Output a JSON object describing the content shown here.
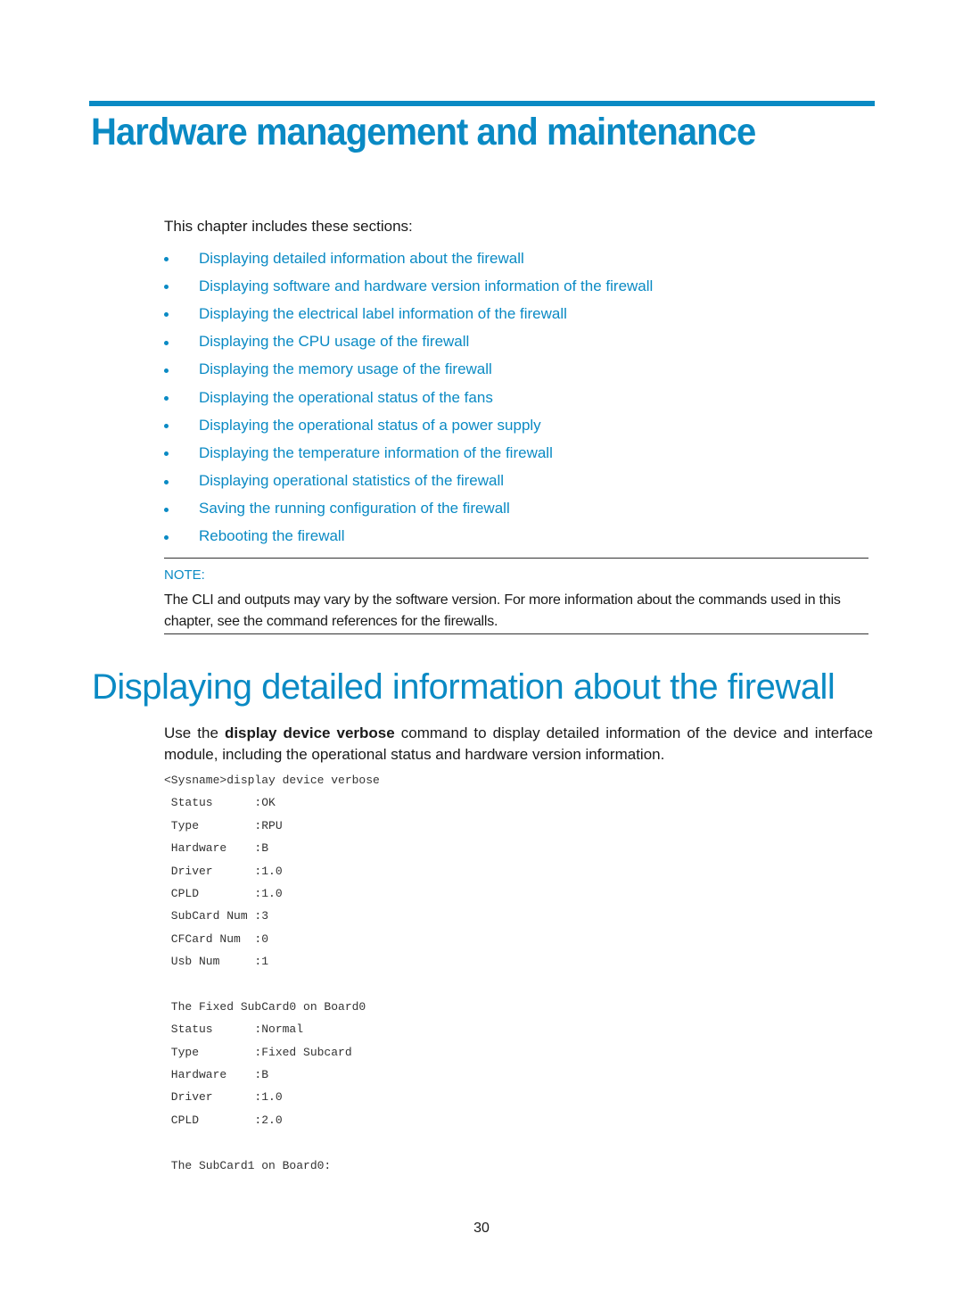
{
  "chapter": {
    "title": "Hardware management and maintenance",
    "intro": "This chapter includes these sections:",
    "toc": [
      "Displaying detailed information about the firewall",
      "Displaying software and hardware version information of the firewall",
      "Displaying the electrical label information of the firewall",
      "Displaying the CPU usage of the firewall",
      "Displaying the memory usage of the firewall",
      "Displaying the operational status of the fans",
      "Displaying the operational status of a power supply",
      "Displaying the temperature information of the firewall",
      "Displaying operational statistics of the firewall",
      "Saving the running configuration of the firewall",
      "Rebooting the firewall"
    ]
  },
  "note": {
    "label": "NOTE:",
    "text": "The CLI and outputs may vary by the software version. For more information about the commands used in this chapter, see the command references for the firewalls."
  },
  "section": {
    "title": "Displaying detailed information about the firewall",
    "para_before": "Use the ",
    "para_command": "display device verbose",
    "para_after": " command to display detailed information of the device and interface module, including the operational status and hardware version information."
  },
  "cli": [
    "<Sysname>display device verbose",
    " Status      :OK",
    " Type        :RPU",
    " Hardware    :B",
    " Driver      :1.0",
    " CPLD        :1.0",
    " SubCard Num :3",
    " CFCard Num  :0",
    " Usb Num     :1",
    "",
    " The Fixed SubCard0 on Board0",
    " Status      :Normal",
    " Type        :Fixed Subcard",
    " Hardware    :B",
    " Driver      :1.0",
    " CPLD        :2.0",
    "",
    " The SubCard1 on Board0:"
  ],
  "page_number": "30",
  "colors": {
    "accent": "#0a8ac4",
    "text": "#1a1a1a"
  }
}
